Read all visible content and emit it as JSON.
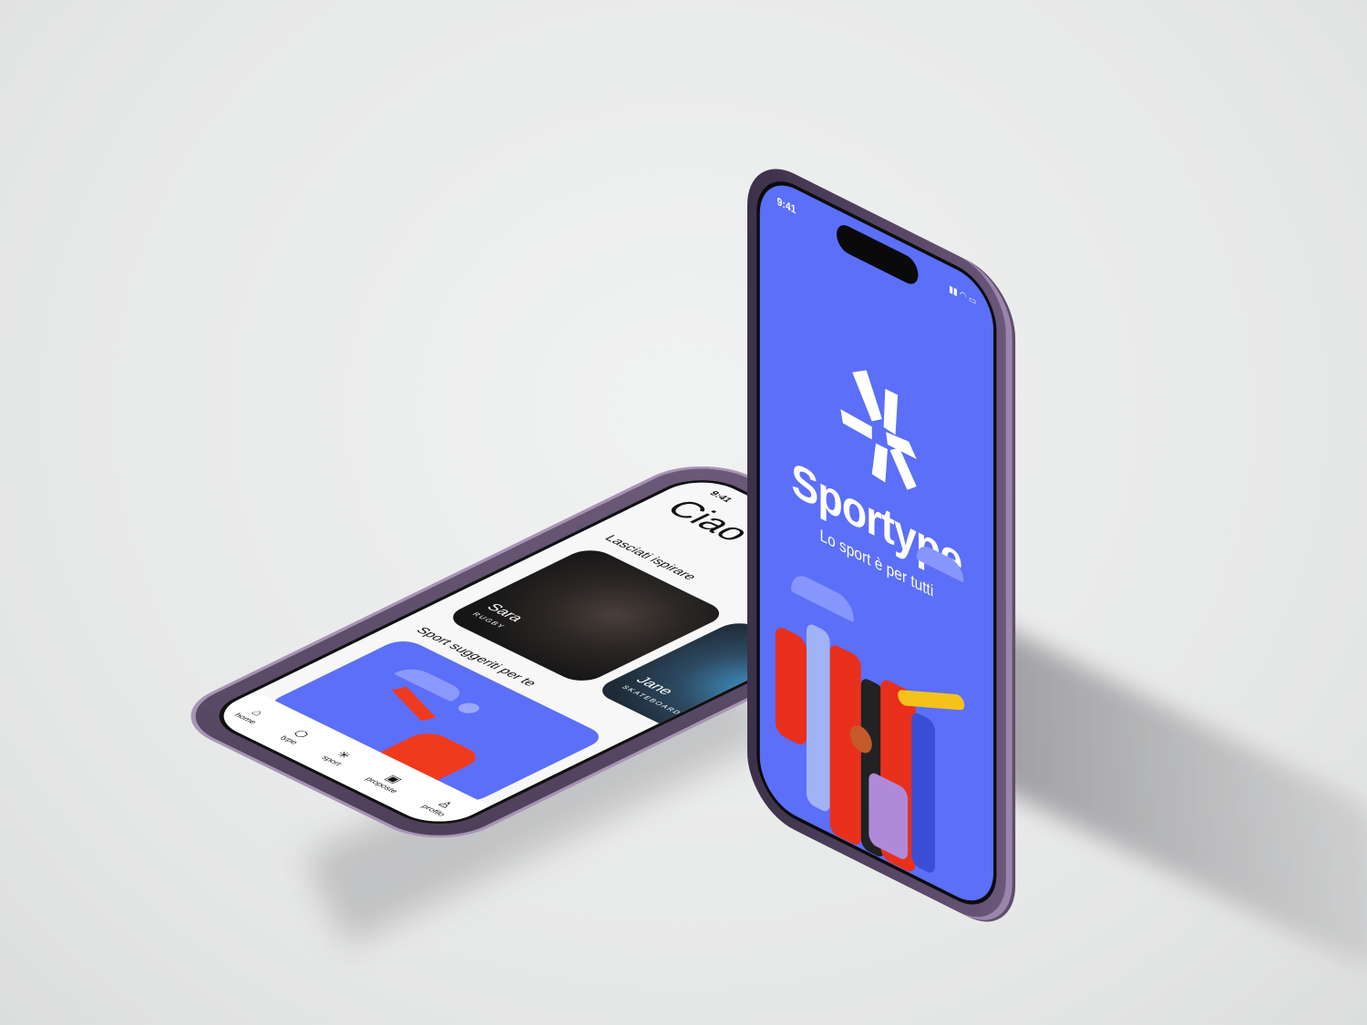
{
  "home_screen": {
    "status_time": "9:41",
    "greeting": "Ciao Cecilia!",
    "inspire_heading": "Lasciati ispirare",
    "cards": [
      {
        "name": "Sara",
        "sport": "RUGBY"
      },
      {
        "name": "Jane",
        "sport": "SKATEBOARD"
      }
    ],
    "suggested_heading": "Sport suggeriti per te",
    "nav": [
      {
        "label": "home",
        "icon": "home-icon"
      },
      {
        "label": "type",
        "icon": "type-icon"
      },
      {
        "label": "sport",
        "icon": "sport-icon"
      },
      {
        "label": "proposte",
        "icon": "proposte-icon"
      },
      {
        "label": "profilo",
        "icon": "profile-icon"
      }
    ]
  },
  "splash_screen": {
    "status_time": "9:41",
    "brand": "Sportype",
    "tagline": "Lo sport è per tutti"
  },
  "colors": {
    "brand_blue": "#5b6ff9",
    "frame_purple": "#6a577a"
  }
}
